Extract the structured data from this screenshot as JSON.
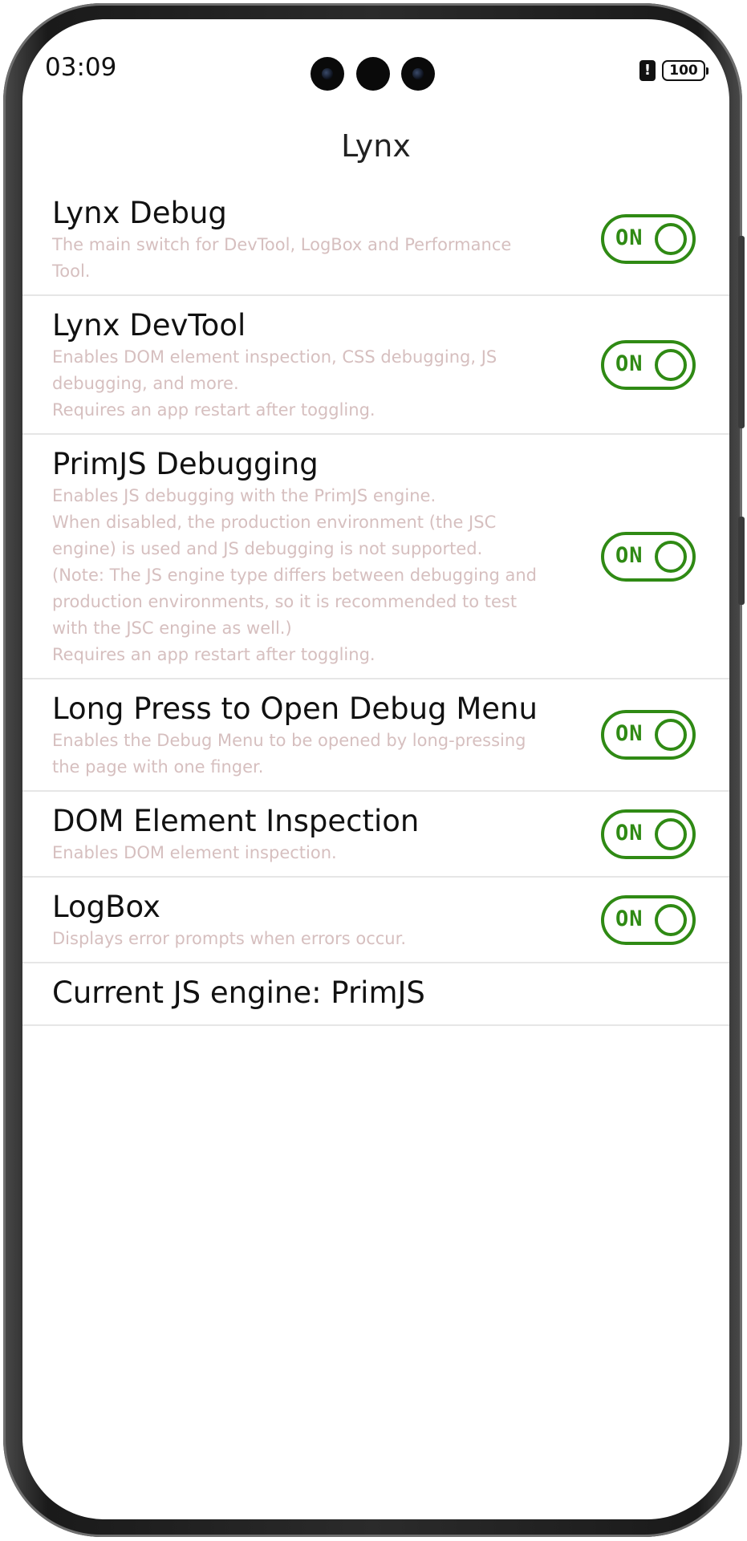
{
  "status_bar": {
    "time": "03:09",
    "battery": "100"
  },
  "nav": {
    "title": "Lynx"
  },
  "settings": [
    {
      "title": "Lynx Debug",
      "description": "The main switch for DevTool, LogBox and Performance\nTool.",
      "toggle": "ON"
    },
    {
      "title": "Lynx DevTool",
      "description": "Enables DOM element inspection, CSS debugging, JS\ndebugging, and more.\nRequires an app restart after toggling.",
      "toggle": "ON"
    },
    {
      "title": "PrimJS Debugging",
      "description": "Enables JS debugging with the PrimJS engine.\nWhen disabled, the production environment (the JSC\nengine) is used and JS debugging is not supported.\n(Note: The JS engine type differs between debugging and\nproduction environments, so it is recommended to test\nwith the JSC engine as well.)\nRequires an app restart after toggling.",
      "toggle": "ON"
    },
    {
      "title": "Long Press to Open Debug Menu",
      "description": "Enables the Debug Menu to be opened by long-pressing\nthe page with one finger.",
      "toggle": "ON"
    },
    {
      "title": "DOM Element Inspection",
      "description": "Enables DOM element inspection.",
      "toggle": "ON"
    },
    {
      "title": "LogBox",
      "description": "Displays error prompts when errors occur.",
      "toggle": "ON"
    }
  ],
  "engine": {
    "label": "Current JS engine: PrimJS"
  },
  "colors": {
    "toggle_on": "#2f8a14",
    "description_text": "#d6bfbf"
  }
}
